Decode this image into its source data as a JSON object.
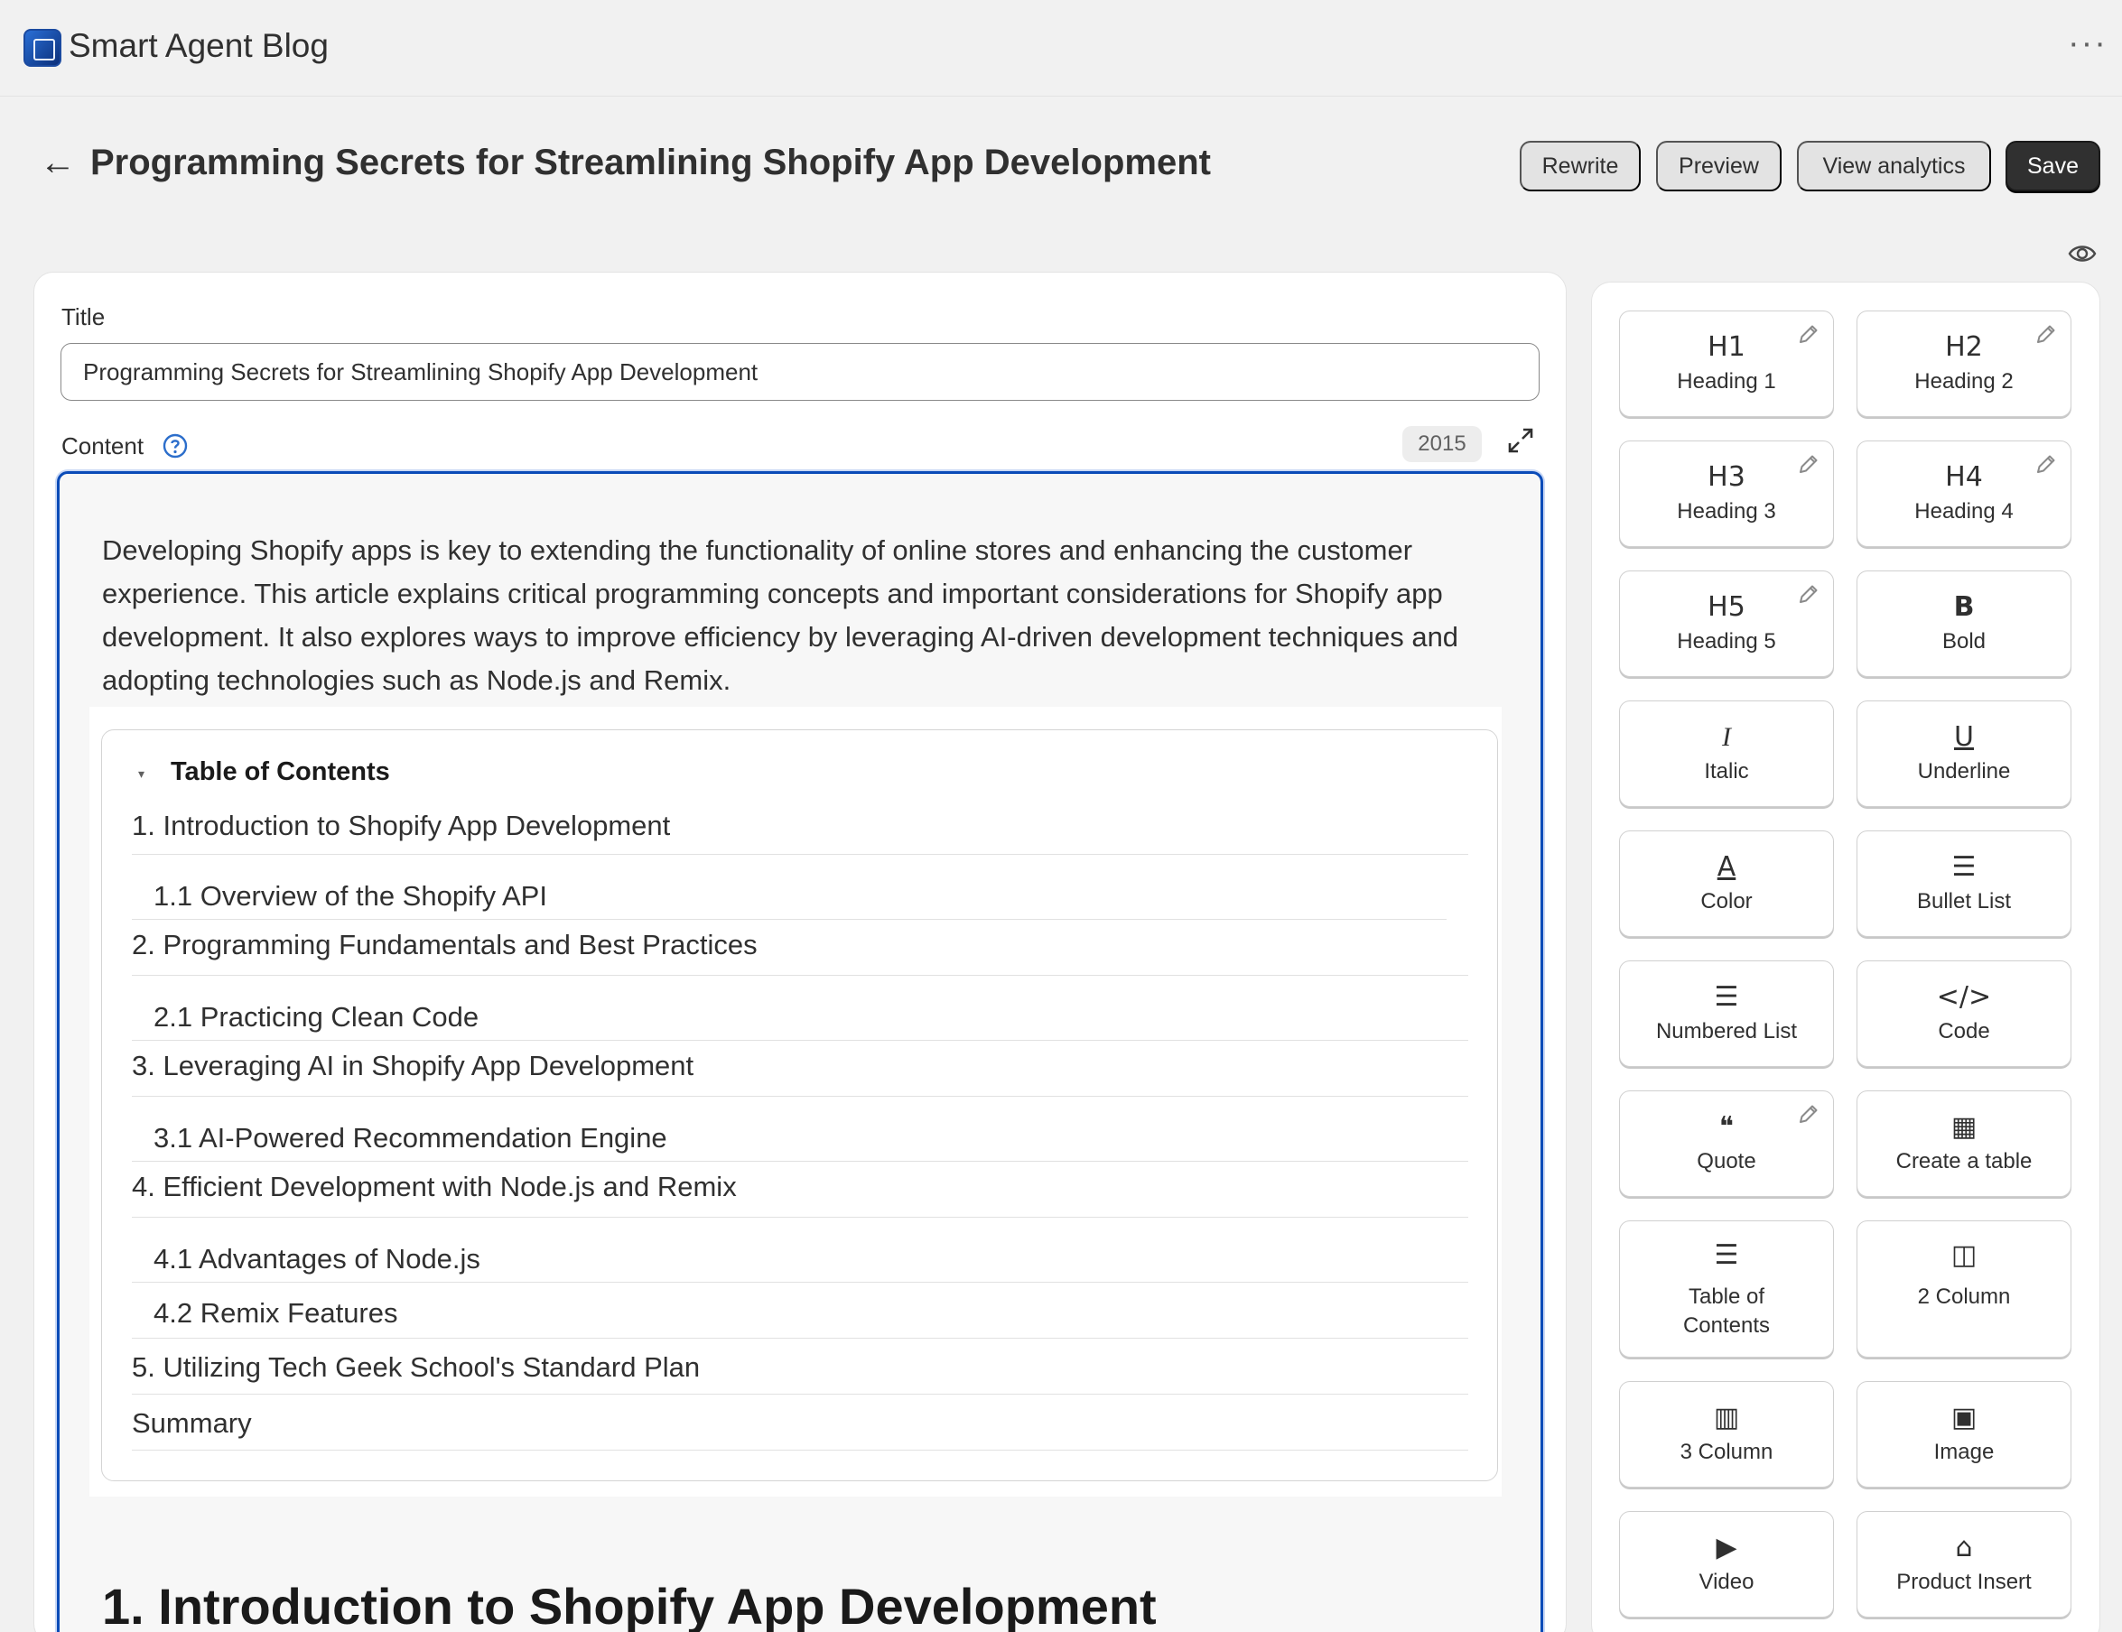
{
  "app": {
    "name": "Smart Agent Blog",
    "menu_glyph": "···"
  },
  "header": {
    "title": "Programming Secrets for Streamlining Shopify App Development",
    "back_glyph": "←",
    "buttons": {
      "rewrite": "Rewrite",
      "preview": "Preview",
      "analytics": "View analytics",
      "save": "Save"
    }
  },
  "editor": {
    "title_label": "Title",
    "title_value": "Programming Secrets for Streamlining Shopify App Development",
    "content_label": "Content",
    "char_count": "2015",
    "intro": "Developing Shopify apps is key to extending the functionality of online stores and enhancing the customer experience. This article explains critical programming concepts and important considerations for Shopify app development. It also explores ways to improve efficiency by leveraging AI-driven development techniques and adopting technologies such as Node.js and Remix.",
    "toc": {
      "title": "Table of Contents",
      "caret": "▾",
      "items": [
        "1. Introduction to Shopify App Development",
        "1.1 Overview of the Shopify API",
        "2. Programming Fundamentals and Best Practices",
        "2.1 Practicing Clean Code",
        "3. Leveraging AI in Shopify App Development",
        "3.1 AI-Powered Recommendation Engine",
        "4. Efficient Development with Node.js and Remix",
        "4.1 Advantages of Node.js",
        "4.2 Remix Features",
        "5. Utilizing Tech Geek School's Standard Plan",
        "Summary"
      ]
    },
    "section_heading": "1. Introduction to Shopify App Development"
  },
  "toolbar": {
    "tools": [
      {
        "label": "Heading 1",
        "glyph": "H1",
        "icon": "heading-1-icon"
      },
      {
        "label": "Heading 2",
        "glyph": "H2",
        "icon": "heading-2-icon"
      },
      {
        "label": "Heading 3",
        "glyph": "H3",
        "icon": "heading-3-icon"
      },
      {
        "label": "Heading 4",
        "glyph": "H4",
        "icon": "heading-4-icon"
      },
      {
        "label": "Heading 5",
        "glyph": "H5",
        "icon": "heading-5-icon"
      },
      {
        "label": "Bold",
        "glyph": "B",
        "icon": "bold-icon"
      },
      {
        "label": "Italic",
        "glyph": "I",
        "icon": "italic-icon"
      },
      {
        "label": "Underline",
        "glyph": "U",
        "icon": "underline-icon"
      },
      {
        "label": "Color",
        "glyph": "A",
        "icon": "text-color-icon"
      },
      {
        "label": "Bullet List",
        "glyph": "☰",
        "icon": "bullet-list-icon"
      },
      {
        "label": "Numbered List",
        "glyph": "☰",
        "icon": "numbered-list-icon"
      },
      {
        "label": "Code",
        "glyph": "</>",
        "icon": "code-icon"
      },
      {
        "label": "Quote",
        "glyph": "❝",
        "icon": "quote-icon"
      },
      {
        "label": "Create a table",
        "glyph": "▦",
        "icon": "table-icon"
      },
      {
        "label": "Table of Contents",
        "glyph": "☰",
        "icon": "table-of-contents-icon"
      },
      {
        "label": "2 Column",
        "glyph": "◫",
        "icon": "two-column-icon"
      },
      {
        "label": "3 Column",
        "glyph": "▥",
        "icon": "three-column-icon"
      },
      {
        "label": "Image",
        "glyph": "▣",
        "icon": "image-icon"
      },
      {
        "label": "Video",
        "glyph": "▶",
        "icon": "video-icon"
      },
      {
        "label": "Product Insert",
        "glyph": "⌂",
        "icon": "product-tag-icon"
      }
    ]
  },
  "colors": {
    "accent_blue": "#0a4bb8",
    "save_button": "#303030",
    "background": "#f1f1f1"
  }
}
